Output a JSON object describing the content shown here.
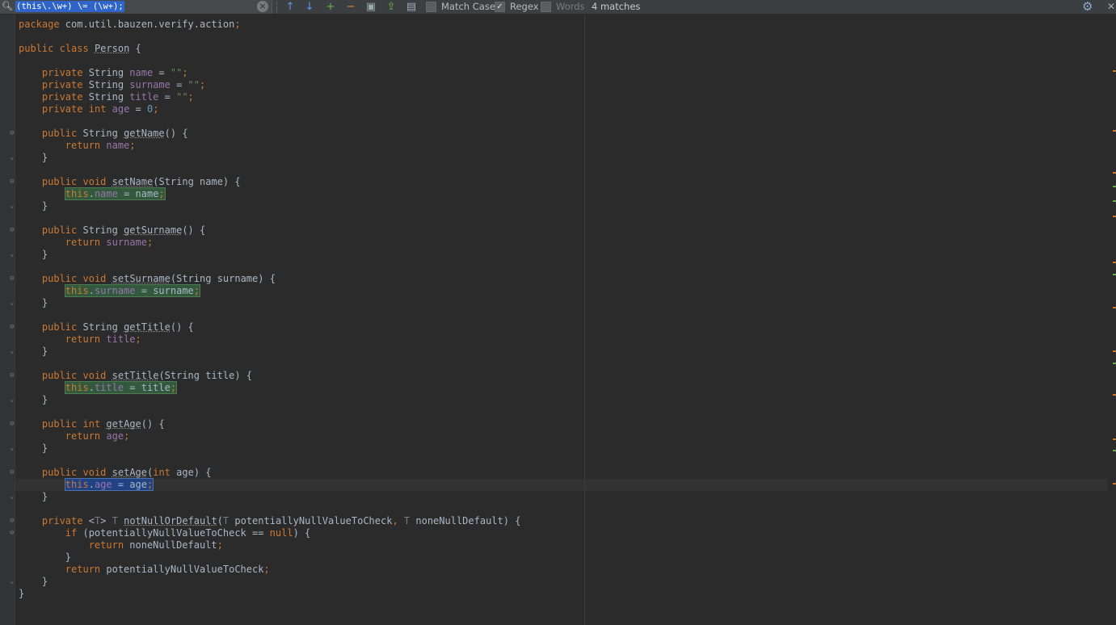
{
  "findbar": {
    "query": "(this\\.\\w+) \\= (\\w+);",
    "match_case_label": "Match Case",
    "match_case_checked": false,
    "regex_label": "Regex",
    "regex_checked": true,
    "words_label": "Words",
    "words_checked": false,
    "status": "4 matches",
    "icons": [
      "search-icon",
      "clear-icon",
      "previous-occurrence-icon",
      "next-occurrence-icon",
      "add-occurrence-icon",
      "remove-occurrence-icon",
      "select-all-occurrences-icon",
      "export-icon",
      "filter-icon",
      "settings-icon",
      "close-icon"
    ]
  },
  "editor": {
    "lines": [
      "package com.util.bauzen.verify.action;",
      "",
      "public class Person {",
      "",
      "    private String name = \"\";",
      "    private String surname = \"\";",
      "    private String title = \"\";",
      "    private int age = 0;",
      "",
      "    public String getName() {",
      "        return name;",
      "    }",
      "",
      "    public void setName(String name) {",
      "        this.name = name;",
      "    }",
      "",
      "    public String getSurname() {",
      "        return surname;",
      "    }",
      "",
      "    public void setSurname(String surname) {",
      "        this.surname = surname;",
      "    }",
      "",
      "    public String getTitle() {",
      "        return title;",
      "    }",
      "",
      "    public void setTitle(String title) {",
      "        this.title = title;",
      "    }",
      "",
      "    public int getAge() {",
      "        return age;",
      "    }",
      "",
      "    public void setAge(int age) {",
      "        this.age = age;",
      "    }",
      "",
      "    private <T> T notNullOrDefault(T potentiallyNullValueToCheck, T noneNullDefault) {",
      "        if (potentiallyNullValueToCheck == null) {",
      "            return noneNullDefault;",
      "        }",
      "        return potentiallyNullValueToCheck;",
      "    }",
      "}"
    ]
  },
  "colors": {
    "keyword": "#cc7832",
    "field": "#9876aa",
    "string": "#6a8759",
    "number": "#6897bb",
    "text": "#a9b7c6",
    "match_highlight": "#32593d",
    "selected_match": "#214283"
  }
}
